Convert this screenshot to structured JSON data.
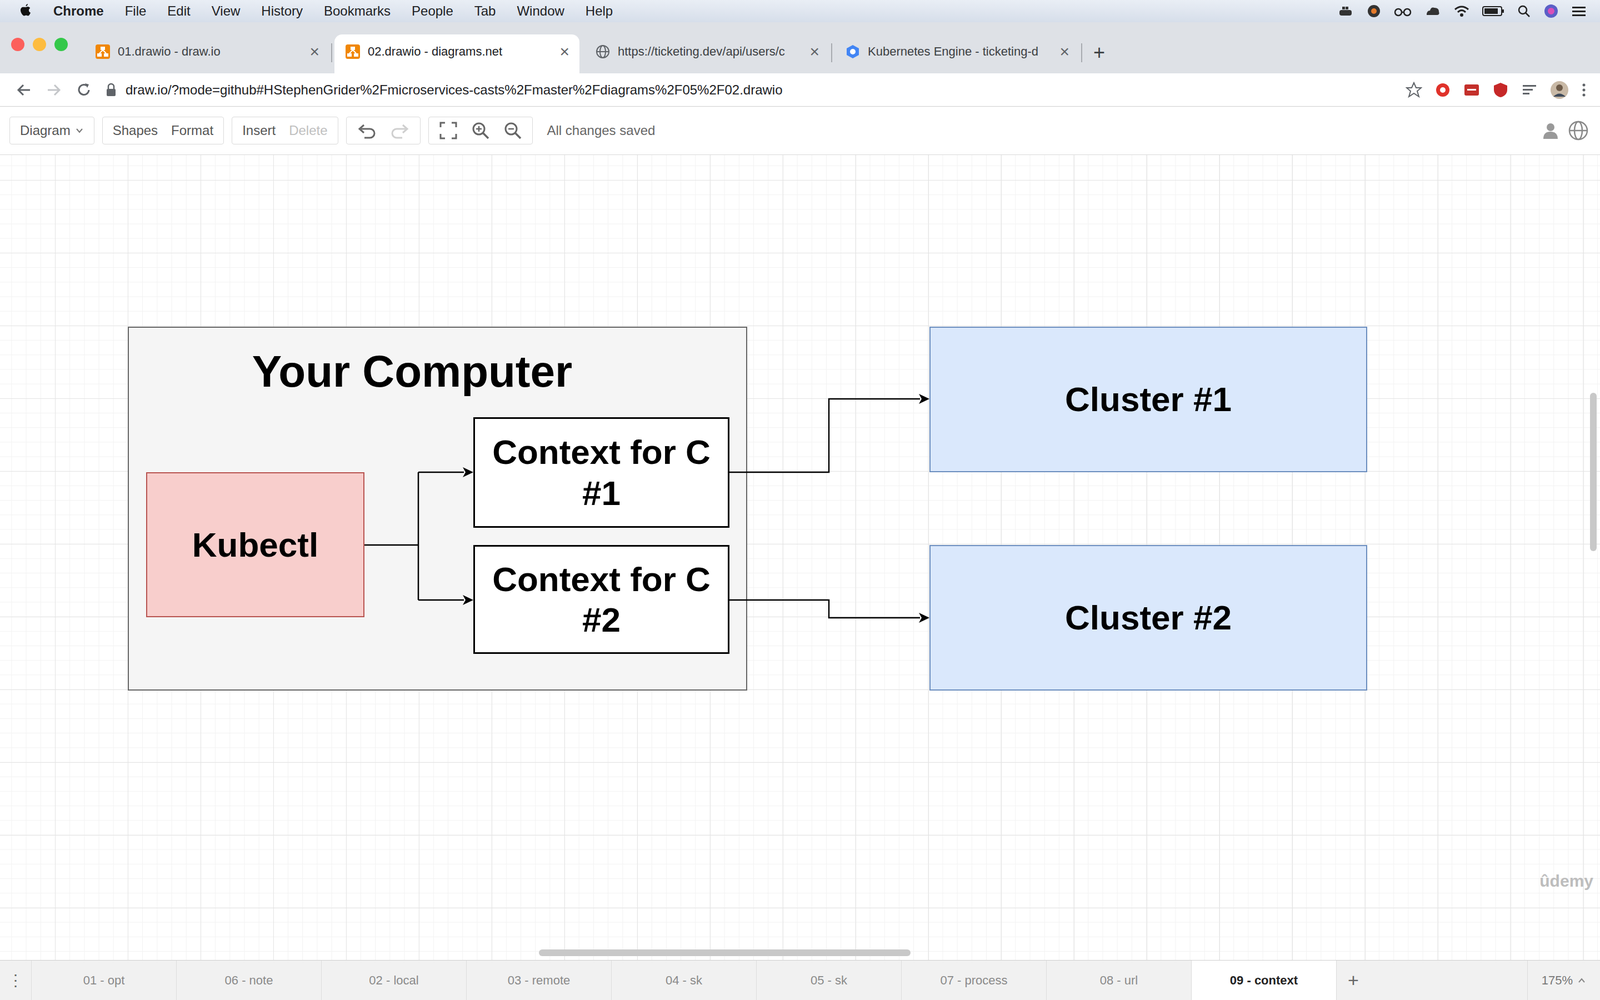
{
  "menubar": {
    "items": [
      "Chrome",
      "File",
      "Edit",
      "View",
      "History",
      "Bookmarks",
      "People",
      "Tab",
      "Window",
      "Help"
    ]
  },
  "browser": {
    "tabs": [
      {
        "label": "01.drawio - draw.io",
        "selected": false,
        "close": "×"
      },
      {
        "label": "02.drawio - diagrams.net",
        "selected": true,
        "close": "×"
      },
      {
        "label": "https://ticketing.dev/api/users/c",
        "selected": false,
        "close": "×"
      },
      {
        "label": "Kubernetes Engine - ticketing-d",
        "selected": false,
        "close": "×"
      }
    ],
    "new_tab": "+",
    "address": "draw.io/?mode=github#HStephenGrider%2Fmicroservices-casts%2Fmaster%2Fdiagrams%2F05%2F02.drawio"
  },
  "toolbar": {
    "diagram": "Diagram",
    "shapes": "Shapes",
    "format": "Format",
    "insert": "Insert",
    "delete": {
      "label": "Delete",
      "disabled": true
    },
    "redo_disabled": true,
    "status": "All changes saved"
  },
  "diagram": {
    "nodes": [
      {
        "label": "Your Computer",
        "kind": "container"
      },
      {
        "label": "Kubectl",
        "kind": "tool"
      },
      {
        "label": "Context for C #1",
        "kind": "context"
      },
      {
        "label": "Context for C #2",
        "kind": "context"
      },
      {
        "label": "Cluster #1",
        "kind": "cluster"
      },
      {
        "label": "Cluster #2",
        "kind": "cluster"
      }
    ]
  },
  "pages": [
    {
      "label": "01 - opt",
      "selected": false
    },
    {
      "label": "06 - note",
      "selected": false
    },
    {
      "label": "02 - local",
      "selected": false
    },
    {
      "label": "03 - remote",
      "selected": false
    },
    {
      "label": "04 - sk",
      "selected": false
    },
    {
      "label": "05 - sk",
      "selected": false
    },
    {
      "label": "07 - process",
      "selected": false
    },
    {
      "label": "08 - url",
      "selected": false
    },
    {
      "label": "09 - context",
      "selected": true
    }
  ],
  "page_menu": "⋮",
  "add_page": "+",
  "zoom": "175%",
  "watermark": "ûdemy"
}
